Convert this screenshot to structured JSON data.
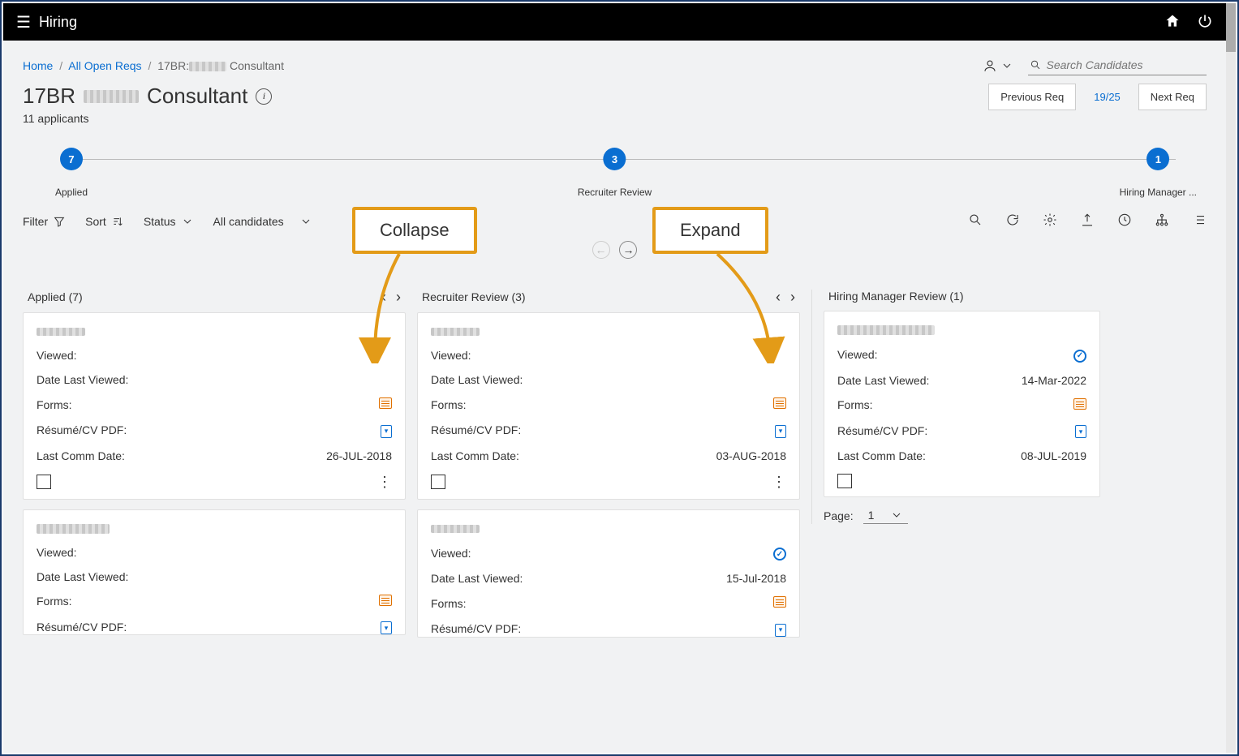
{
  "app": {
    "title": "Hiring"
  },
  "breadcrumb": {
    "home": "Home",
    "reqs": "All Open Reqs",
    "current_prefix": "17BR:",
    "current_suffix": " Consultant"
  },
  "search": {
    "placeholder": "Search Candidates"
  },
  "page": {
    "title_prefix": "17BR",
    "title_suffix": "Consultant",
    "applicants": "11 applicants"
  },
  "reqnav": {
    "prev": "Previous Req",
    "counter": "19/25",
    "next": "Next Req"
  },
  "stages": [
    {
      "count": "7",
      "label": "Applied"
    },
    {
      "count": "3",
      "label": "Recruiter Review"
    },
    {
      "count": "1",
      "label": "Hiring Manager ..."
    }
  ],
  "toolbar": {
    "filter": "Filter",
    "sort": "Sort",
    "status": "Status",
    "all": "All candidates"
  },
  "annotations": {
    "collapse": "Collapse",
    "expand": "Expand"
  },
  "labels": {
    "viewed": "Viewed:",
    "date_last_viewed": "Date Last Viewed:",
    "forms": "Forms:",
    "resume": "Résumé/CV PDF:",
    "last_comm": "Last Comm Date:",
    "page": "Page:"
  },
  "columns": [
    {
      "title": "Applied (7)",
      "cards": [
        {
          "viewed": "",
          "date_last_viewed": "",
          "last_comm": "26-JUL-2018",
          "show_more": true
        },
        {
          "viewed": "",
          "date_last_viewed": "",
          "last_comm": "",
          "partial": true
        }
      ]
    },
    {
      "title": "Recruiter Review (3)",
      "cards": [
        {
          "viewed": "",
          "date_last_viewed": "",
          "last_comm": "03-AUG-2018",
          "show_more": true
        },
        {
          "viewed_check": true,
          "date_last_viewed": "15-Jul-2018",
          "last_comm": "",
          "partial": true
        }
      ]
    },
    {
      "title": "Hiring Manager Review (1)",
      "cards": [
        {
          "viewed_check": true,
          "date_last_viewed": "14-Mar-2022",
          "last_comm": "08-JUL-2019",
          "show_more": false
        }
      ],
      "page_value": "1"
    }
  ]
}
